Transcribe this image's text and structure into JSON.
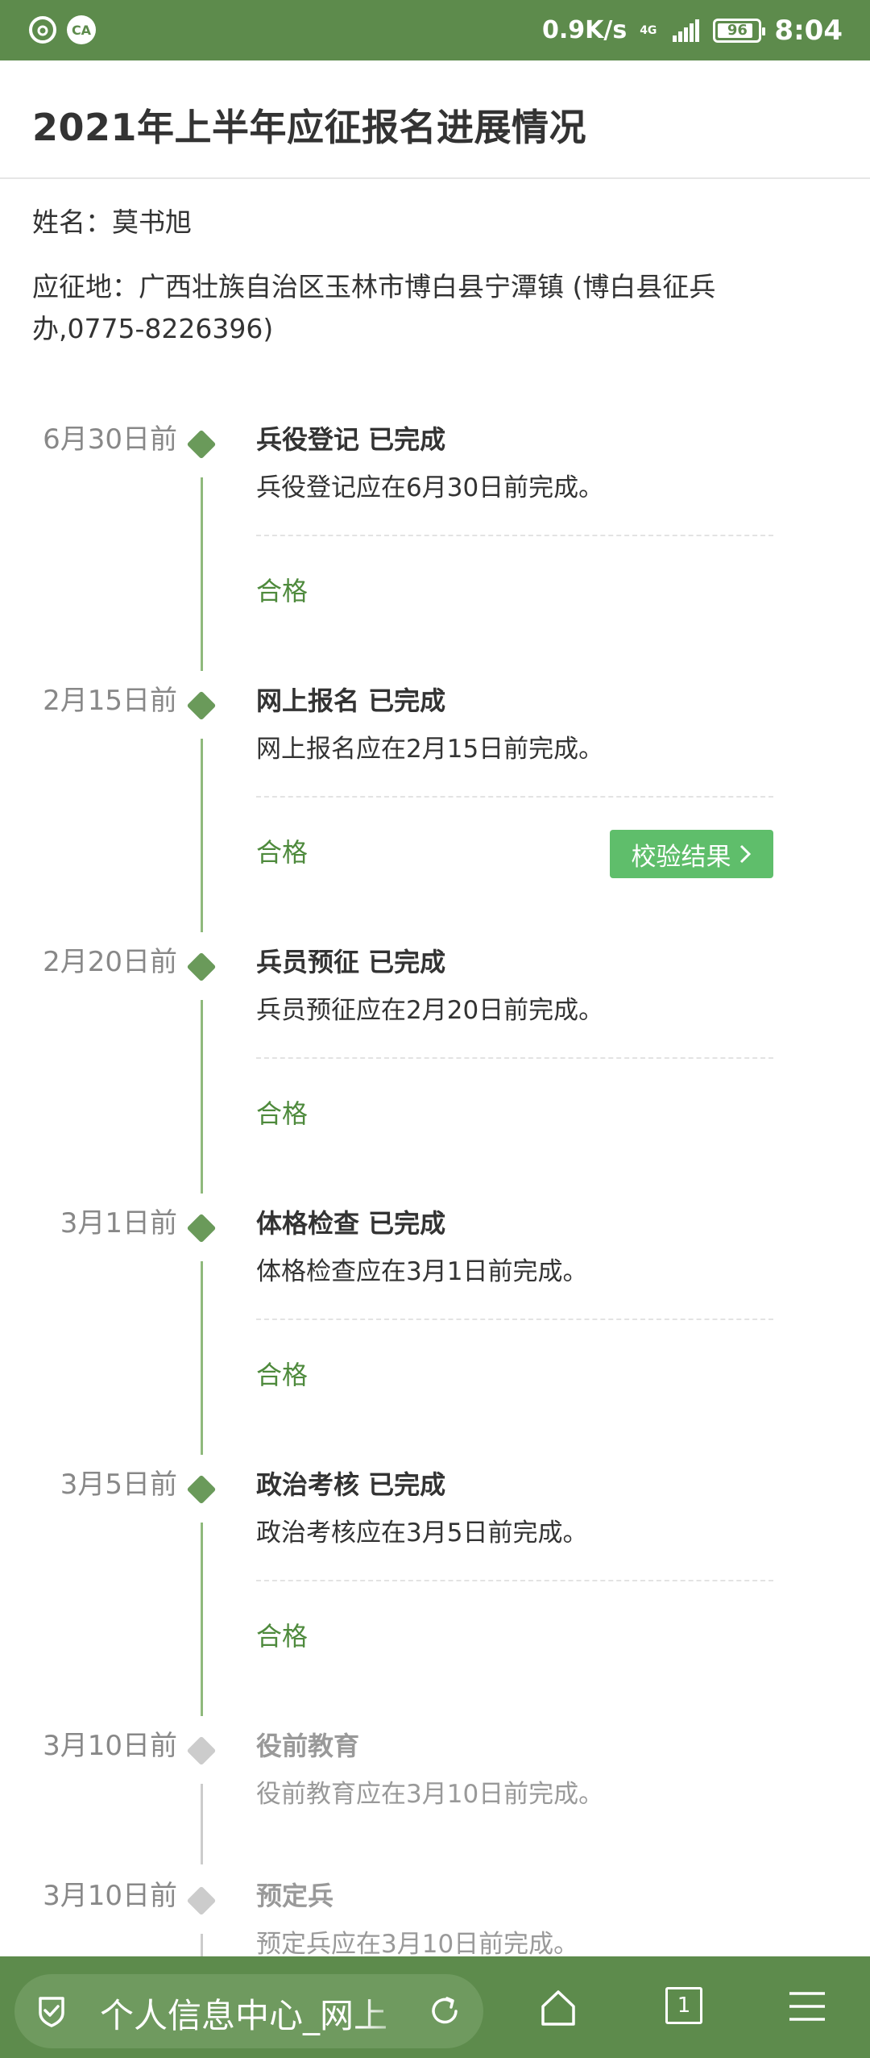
{
  "status_bar": {
    "speed": "0.9K/s",
    "network": "4G",
    "battery": "96",
    "time": "8:04"
  },
  "page": {
    "title": "2021年上半年应征报名进展情况",
    "name_line": "姓名：莫书旭",
    "location_line": "应征地：广西壮族自治区玉林市博白县宁潭镇 (博白县征兵办,0775-8226396)"
  },
  "timeline": [
    {
      "date": "6月30日前",
      "title": "兵役登记 已完成",
      "desc": "兵役登记应在6月30日前完成。",
      "result": "合格",
      "status": "done"
    },
    {
      "date": "2月15日前",
      "title": "网上报名 已完成",
      "desc": "网上报名应在2月15日前完成。",
      "result": "合格",
      "status": "done",
      "button": "校验结果"
    },
    {
      "date": "2月20日前",
      "title": "兵员预征 已完成",
      "desc": "兵员预征应在2月20日前完成。",
      "result": "合格",
      "status": "done"
    },
    {
      "date": "3月1日前",
      "title": "体格检查 已完成",
      "desc": "体格检查应在3月1日前完成。",
      "result": "合格",
      "status": "done"
    },
    {
      "date": "3月5日前",
      "title": "政治考核 已完成",
      "desc": "政治考核应在3月5日前完成。",
      "result": "合格",
      "status": "done"
    },
    {
      "date": "3月10日前",
      "title": "役前教育",
      "desc": "役前教育应在3月10日前完成。",
      "status": "pending"
    },
    {
      "date": "3月10日前",
      "title": "预定兵",
      "desc": "预定兵应在3月10日前完成。",
      "status": "pending"
    }
  ],
  "colors": {
    "brand_green": "#5d8b4c",
    "done_marker": "#6a9a5a",
    "pending_marker": "#cccccc",
    "result_text": "#4e8a3c",
    "button_bg": "#5fbe6b"
  },
  "bottom_bar": {
    "url_text": "个人信息中心_网上",
    "tab_count": "1",
    "icons": [
      "shield-check-icon",
      "refresh-icon",
      "home-icon",
      "tabs-icon",
      "menu-icon"
    ]
  }
}
